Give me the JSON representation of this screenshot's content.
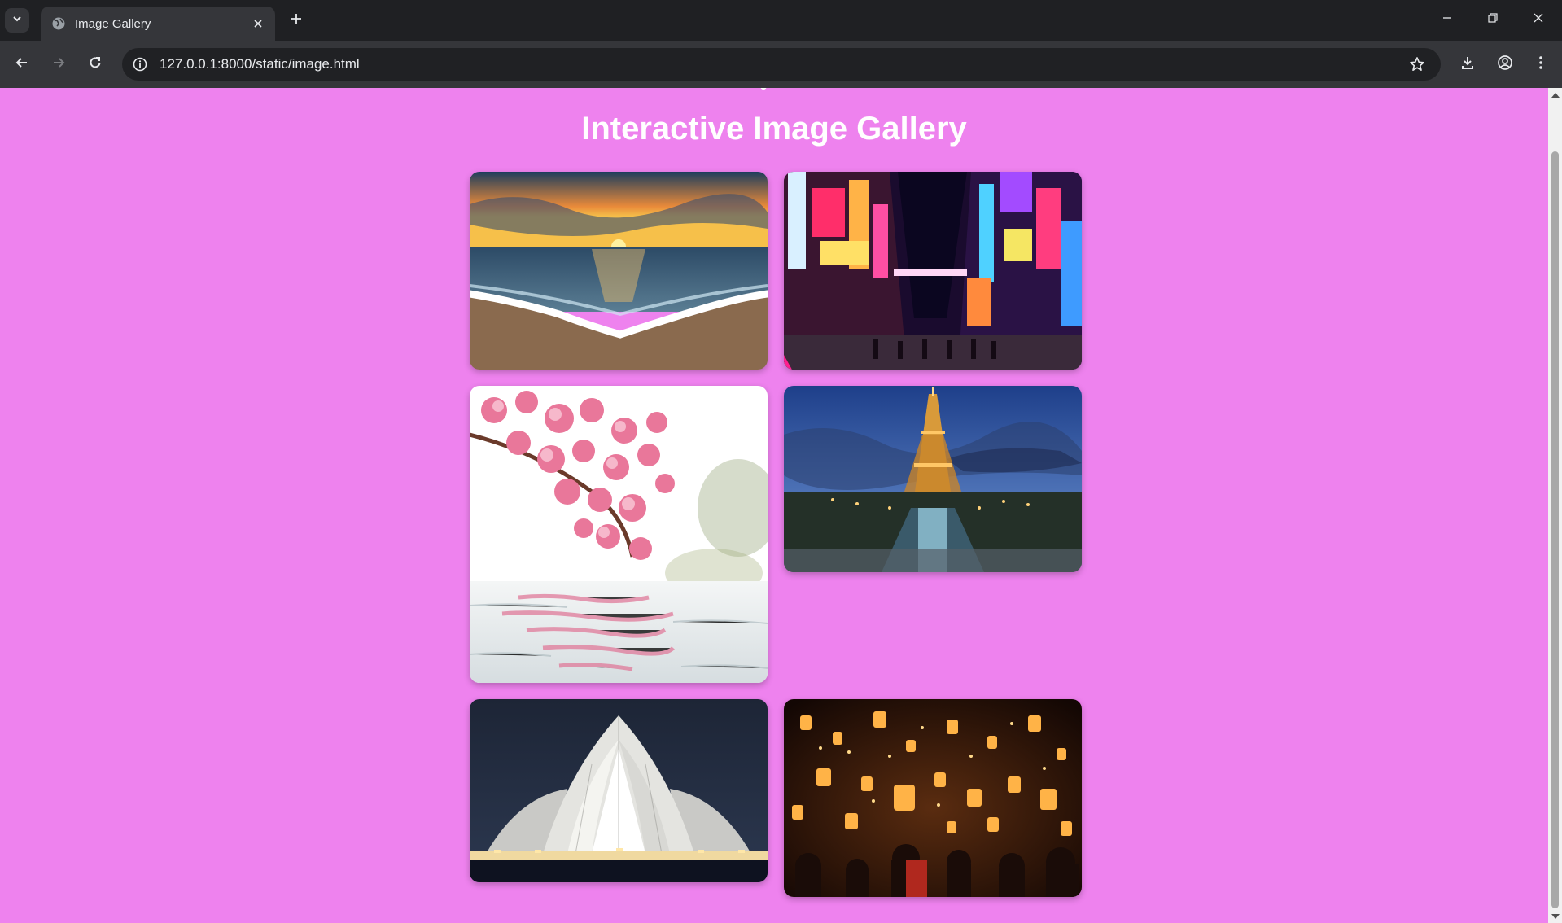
{
  "browser": {
    "tab_title": "Image Gallery",
    "url": "127.0.0.1:8000/static/image.html"
  },
  "page": {
    "title": "Interactive Image Gallery",
    "background": "#ee82ee"
  },
  "gallery": {
    "images": [
      {
        "subject": "sunset over ocean beach"
      },
      {
        "subject": "neon-lit city street at night"
      },
      {
        "subject": "cherry blossoms reflected in water"
      },
      {
        "subject": "Eiffel Tower at dusk"
      },
      {
        "subject": "Lotus Temple illuminated at night"
      },
      {
        "subject": "floating sky lanterns festival"
      }
    ]
  }
}
